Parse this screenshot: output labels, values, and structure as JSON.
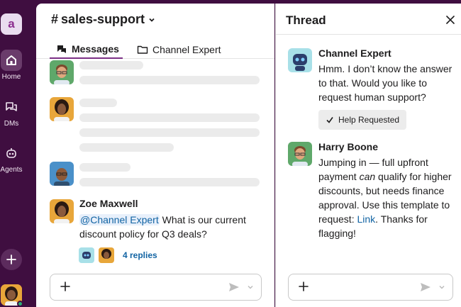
{
  "sidebar": {
    "workspace_initial": "a",
    "items": [
      {
        "label": "Home",
        "icon": "home-icon"
      },
      {
        "label": "DMs",
        "icon": "dms-icon"
      },
      {
        "label": "Agents",
        "icon": "agents-icon"
      }
    ]
  },
  "channel": {
    "name": "sales-support",
    "tabs": [
      {
        "label": "Messages",
        "icon": "messages-icon"
      },
      {
        "label": "Channel Expert",
        "icon": "folder-icon"
      }
    ]
  },
  "message": {
    "author": "Zoe Maxwell",
    "mention": "@Channel Expert",
    "text_line1": " What is our current",
    "text_line2": "discount policy for Q3 deals?",
    "replies_label": "4 replies"
  },
  "thread": {
    "title": "Thread",
    "bot_name": "Channel Expert",
    "bot_lines": [
      "Hmm. I don’t know the answer",
      "to that. Would you like to",
      "request human support?"
    ],
    "help_requested_label": "Help Requested",
    "reply_author": "Harry Boone",
    "reply_line1": "Jumping in — full upfront",
    "reply_line2_pre": "payment ",
    "reply_line2_em": "can",
    "reply_line2_post": " qualify for higher",
    "reply_line3": "discounts, but needs finance",
    "reply_line4": "approval. Use this template to",
    "reply_line5_pre": "request: ",
    "reply_line5_link": "Link",
    "reply_line5_post": ". Thanks for",
    "reply_line6": "flagging!"
  },
  "colors": {
    "sidebar_bg": "#3f0e40",
    "link": "#1264a3",
    "tab_underline": "#7c3085"
  }
}
